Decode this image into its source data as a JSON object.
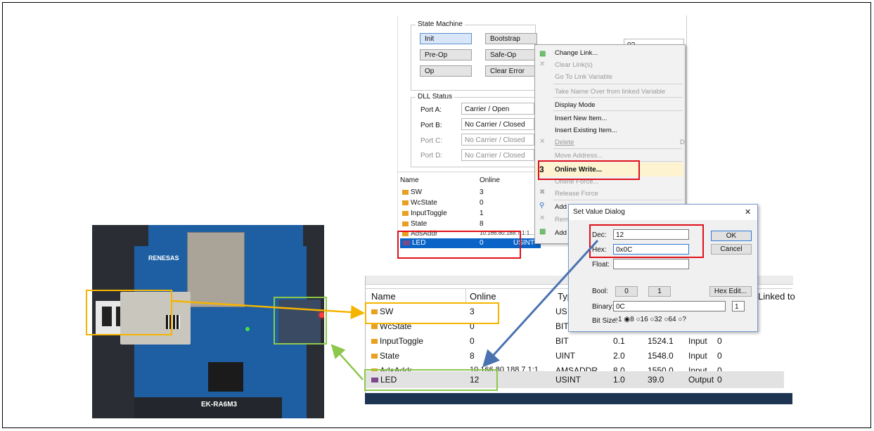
{
  "photo": {
    "renesas_logo": "RENESAS",
    "board_brand": "EK-RA6M3",
    "module_label": "RENESAS"
  },
  "state_machine": {
    "title": "State Machine",
    "buttons": [
      "Init",
      "Bootstrap",
      "Pre-Op",
      "Safe-Op",
      "Op",
      "Clear Error"
    ],
    "side_field": "0?"
  },
  "dll_status": {
    "title": "DLL Status",
    "ports": [
      {
        "label": "Port A:",
        "value": "Carrier / Open",
        "dim": false
      },
      {
        "label": "Port B:",
        "value": "No Carrier / Closed",
        "dim": false
      },
      {
        "label": "Port C:",
        "value": "No Carrier / Closed",
        "dim": true
      },
      {
        "label": "Port D:",
        "value": "No Carrier / Closed",
        "dim": true
      }
    ]
  },
  "top_table": {
    "headers": [
      "Name",
      "Online"
    ],
    "rows": [
      {
        "name": "SW",
        "online": "3"
      },
      {
        "name": "WcState",
        "online": "0"
      },
      {
        "name": "InputToggle",
        "online": "1"
      },
      {
        "name": "State",
        "online": "8"
      },
      {
        "name": "AdsAddr",
        "online": "10.166.80.188.7.1:1..."
      },
      {
        "name": "LED",
        "online": "0",
        "type": "USINT"
      }
    ]
  },
  "context_menu": {
    "items": [
      {
        "label": "Change Link...",
        "dim": false
      },
      {
        "label": "Clear Link(s)",
        "dim": true
      },
      {
        "label": "Go To Link Variable",
        "dim": true
      },
      {
        "label": "Take Name Over from linked Variable",
        "dim": true
      },
      {
        "label": "Display Mode",
        "dim": false
      },
      {
        "label": "Insert New Item...",
        "dim": false
      },
      {
        "label": "Insert Existing Item...",
        "dim": false
      },
      {
        "label": "Delete",
        "dim": true
      },
      {
        "label": "Move Address...",
        "dim": true
      },
      {
        "label": "Online Write...",
        "dim": false
      },
      {
        "label": "Online Force...",
        "dim": true
      },
      {
        "label": "Release Force",
        "dim": true
      },
      {
        "label": "Add to Watch",
        "dim": false
      },
      {
        "label": "Remove from Watch",
        "dim": true
      },
      {
        "label": "Add to",
        "dim": false
      }
    ],
    "shortcut_delete": "D",
    "step_number": "3"
  },
  "set_value_dialog": {
    "title": "Set Value Dialog",
    "close": "✕",
    "dec_label": "Dec:",
    "dec_value": "12",
    "hex_label": "Hex:",
    "hex_value": "0x0C",
    "float_label": "Float:",
    "float_value": "",
    "bool_label": "Bool:",
    "bool_0": "0",
    "bool_1": "1",
    "hex_edit": "Hex Edit...",
    "binary_label": "Binary:",
    "binary_value": "0C",
    "binary_size": "1",
    "bitsize_label": "Bit Size:",
    "bitsize_options": [
      "1",
      "8",
      "16",
      "32",
      "64",
      "?"
    ],
    "bitsize_selected": "8",
    "ok": "OK",
    "cancel": "Cancel"
  },
  "bottom_table": {
    "headers": [
      "Name",
      "Online",
      "Type",
      "Linked to"
    ],
    "rows": [
      {
        "name": "SW",
        "online": "3",
        "type": "US",
        "size": "",
        "addr": "",
        "io": "",
        "user": ""
      },
      {
        "name": "WcState",
        "online": "0",
        "type": "BIT",
        "size": "",
        "addr": "",
        "io": "",
        "user": ""
      },
      {
        "name": "InputToggle",
        "online": "0",
        "type": "BIT",
        "size": "0.1",
        "addr": "1524.1",
        "io": "Input",
        "user": "0"
      },
      {
        "name": "State",
        "online": "8",
        "type": "UINT",
        "size": "2.0",
        "addr": "1548.0",
        "io": "Input",
        "user": "0"
      },
      {
        "name": "AdsAddr",
        "online": "10.166.80.188.7.1:1...",
        "type": "AMSADDR",
        "size": "8.0",
        "addr": "1550.0",
        "io": "Input",
        "user": "0"
      },
      {
        "name": "LED",
        "online": "12",
        "type": "USINT",
        "size": "1.0",
        "addr": "39.0",
        "io": "Output",
        "user": "0"
      }
    ]
  },
  "colors": {
    "red_box": "#e0101a",
    "orange_box": "#f5b400",
    "green_box": "#8cc84b",
    "blue_arrow": "#4a72b0",
    "selection_blue": "#0a64c8"
  }
}
